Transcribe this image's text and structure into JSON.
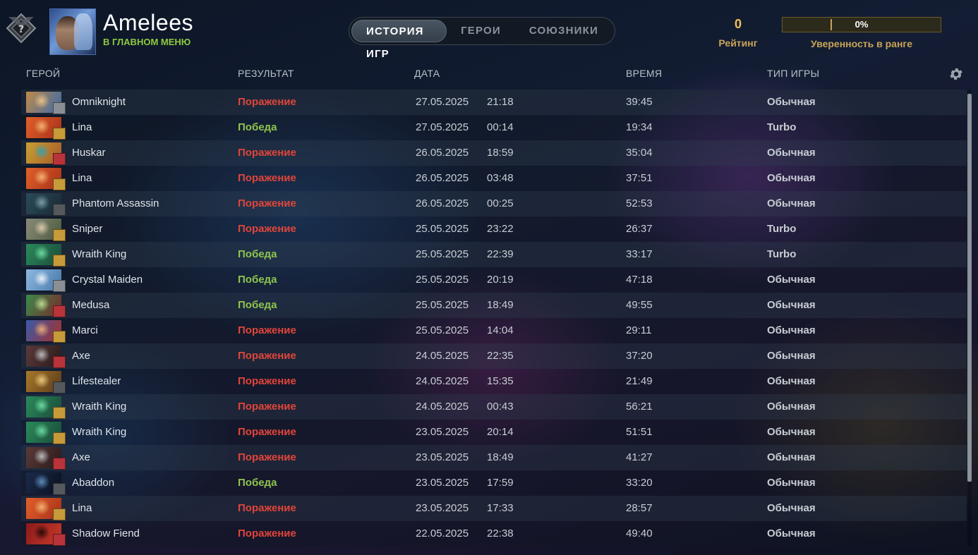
{
  "player": {
    "name": "Amelees",
    "status": "В ГЛАВНОМ МЕНЮ"
  },
  "tabs": [
    {
      "label": "ИСТОРИЯ ИГР",
      "active": true
    },
    {
      "label": "ГЕРОИ",
      "active": false
    },
    {
      "label": "СОЮЗНИКИ",
      "active": false
    }
  ],
  "rating": {
    "value": "0",
    "label": "Рейтинг"
  },
  "confidence": {
    "percent_text": "0%",
    "label": "Уверенность в ранге",
    "fill_fraction": 0
  },
  "columns": {
    "hero": "ГЕРОЙ",
    "result": "РЕЗУЛЬТАТ",
    "date": "ДАТА",
    "duration": "ВРЕМЯ",
    "game_type": "ТИП ИГРЫ"
  },
  "icons": {
    "rank": "unranked-medal-icon",
    "settings": "gear-icon"
  },
  "colors": {
    "loss": "#e0453a",
    "win": "#8fc44e",
    "status": "#8fcb3f",
    "gold": "#c9a458"
  },
  "matches": [
    {
      "hero": "Omniknight",
      "result": "Поражение",
      "outcome": "loss",
      "date": "27.05.2025",
      "time": "21:18",
      "duration": "39:45",
      "type": "Обычная",
      "portrait": [
        "#c08a4a",
        "#e6c08a",
        "#3a6aa8"
      ],
      "attr_color": "#8a8f95"
    },
    {
      "hero": "Lina",
      "result": "Победа",
      "outcome": "win",
      "date": "27.05.2025",
      "time": "00:14",
      "duration": "19:34",
      "type": "Turbo",
      "portrait": [
        "#e0602a",
        "#f2b070",
        "#a83018"
      ],
      "attr_color": "#c79a3a"
    },
    {
      "hero": "Huskar",
      "result": "Поражение",
      "outcome": "loss",
      "date": "26.05.2025",
      "time": "18:59",
      "duration": "35:04",
      "type": "Обычная",
      "portrait": [
        "#c8a032",
        "#3aa0a8",
        "#a85a2a"
      ],
      "attr_color": "#b8343a"
    },
    {
      "hero": "Lina",
      "result": "Поражение",
      "outcome": "loss",
      "date": "26.05.2025",
      "time": "03:48",
      "duration": "37:51",
      "type": "Обычная",
      "portrait": [
        "#e0602a",
        "#f2b070",
        "#a83018"
      ],
      "attr_color": "#c79a3a"
    },
    {
      "hero": "Phantom Assassin",
      "result": "Поражение",
      "outcome": "loss",
      "date": "26.05.2025",
      "time": "00:25",
      "duration": "52:53",
      "type": "Обычная",
      "portrait": [
        "#2a4a5a",
        "#7a9aa8",
        "#1a2a34"
      ],
      "attr_color": "#55595e"
    },
    {
      "hero": "Sniper",
      "result": "Поражение",
      "outcome": "loss",
      "date": "25.05.2025",
      "time": "23:22",
      "duration": "26:37",
      "type": "Turbo",
      "portrait": [
        "#8a8a7a",
        "#d8c8a8",
        "#4a5a3a"
      ],
      "attr_color": "#c79a3a"
    },
    {
      "hero": "Wraith King",
      "result": "Победа",
      "outcome": "win",
      "date": "25.05.2025",
      "time": "22:39",
      "duration": "33:17",
      "type": "Turbo",
      "portrait": [
        "#2a8a5a",
        "#6ad8a0",
        "#1a4a3a"
      ],
      "attr_color": "#c79a3a"
    },
    {
      "hero": "Crystal Maiden",
      "result": "Победа",
      "outcome": "win",
      "date": "25.05.2025",
      "time": "20:19",
      "duration": "47:18",
      "type": "Обычная",
      "portrait": [
        "#8ab8e0",
        "#e8f0f8",
        "#4a78a8"
      ],
      "attr_color": "#8a8f95"
    },
    {
      "hero": "Medusa",
      "result": "Победа",
      "outcome": "win",
      "date": "25.05.2025",
      "time": "18:49",
      "duration": "49:55",
      "type": "Обычная",
      "portrait": [
        "#3a8a4a",
        "#b8d890",
        "#7a2a2a"
      ],
      "attr_color": "#b8343a"
    },
    {
      "hero": "Marci",
      "result": "Поражение",
      "outcome": "loss",
      "date": "25.05.2025",
      "time": "14:04",
      "duration": "29:11",
      "type": "Обычная",
      "portrait": [
        "#3a5aa8",
        "#e8a878",
        "#a8302a"
      ],
      "attr_color": "#c79a3a"
    },
    {
      "hero": "Axe",
      "result": "Поражение",
      "outcome": "loss",
      "date": "24.05.2025",
      "time": "22:35",
      "duration": "37:20",
      "type": "Обычная",
      "portrait": [
        "#5a3a3a",
        "#b8b8b8",
        "#2a1a1a"
      ],
      "attr_color": "#b8343a"
    },
    {
      "hero": "Lifestealer",
      "result": "Поражение",
      "outcome": "loss",
      "date": "24.05.2025",
      "time": "15:35",
      "duration": "21:49",
      "type": "Обычная",
      "portrait": [
        "#a8782a",
        "#e8c878",
        "#5a3a1a"
      ],
      "attr_color": "#55595e"
    },
    {
      "hero": "Wraith King",
      "result": "Поражение",
      "outcome": "loss",
      "date": "24.05.2025",
      "time": "00:43",
      "duration": "56:21",
      "type": "Обычная",
      "portrait": [
        "#2a8a5a",
        "#6ad8a0",
        "#1a4a3a"
      ],
      "attr_color": "#c79a3a"
    },
    {
      "hero": "Wraith King",
      "result": "Поражение",
      "outcome": "loss",
      "date": "23.05.2025",
      "time": "20:14",
      "duration": "51:51",
      "type": "Обычная",
      "portrait": [
        "#2a8a5a",
        "#6ad8a0",
        "#1a4a3a"
      ],
      "attr_color": "#c79a3a"
    },
    {
      "hero": "Axe",
      "result": "Поражение",
      "outcome": "loss",
      "date": "23.05.2025",
      "time": "18:49",
      "duration": "41:27",
      "type": "Обычная",
      "portrait": [
        "#5a3a3a",
        "#b8b8b8",
        "#2a1a1a"
      ],
      "attr_color": "#b8343a"
    },
    {
      "hero": "Abaddon",
      "result": "Победа",
      "outcome": "win",
      "date": "23.05.2025",
      "time": "17:59",
      "duration": "33:20",
      "type": "Обычная",
      "portrait": [
        "#1a2a4a",
        "#5a8ab8",
        "#0a1020"
      ],
      "attr_color": "#55595e"
    },
    {
      "hero": "Lina",
      "result": "Поражение",
      "outcome": "loss",
      "date": "23.05.2025",
      "time": "17:33",
      "duration": "28:57",
      "type": "Обычная",
      "portrait": [
        "#e0602a",
        "#f2b070",
        "#a83018"
      ],
      "attr_color": "#c79a3a"
    },
    {
      "hero": "Shadow Fiend",
      "result": "Поражение",
      "outcome": "loss",
      "date": "22.05.2025",
      "time": "22:38",
      "duration": "49:40",
      "type": "Обычная",
      "portrait": [
        "#8a1a1a",
        "#2a0a0a",
        "#c83a2a"
      ],
      "attr_color": "#b8343a"
    }
  ]
}
